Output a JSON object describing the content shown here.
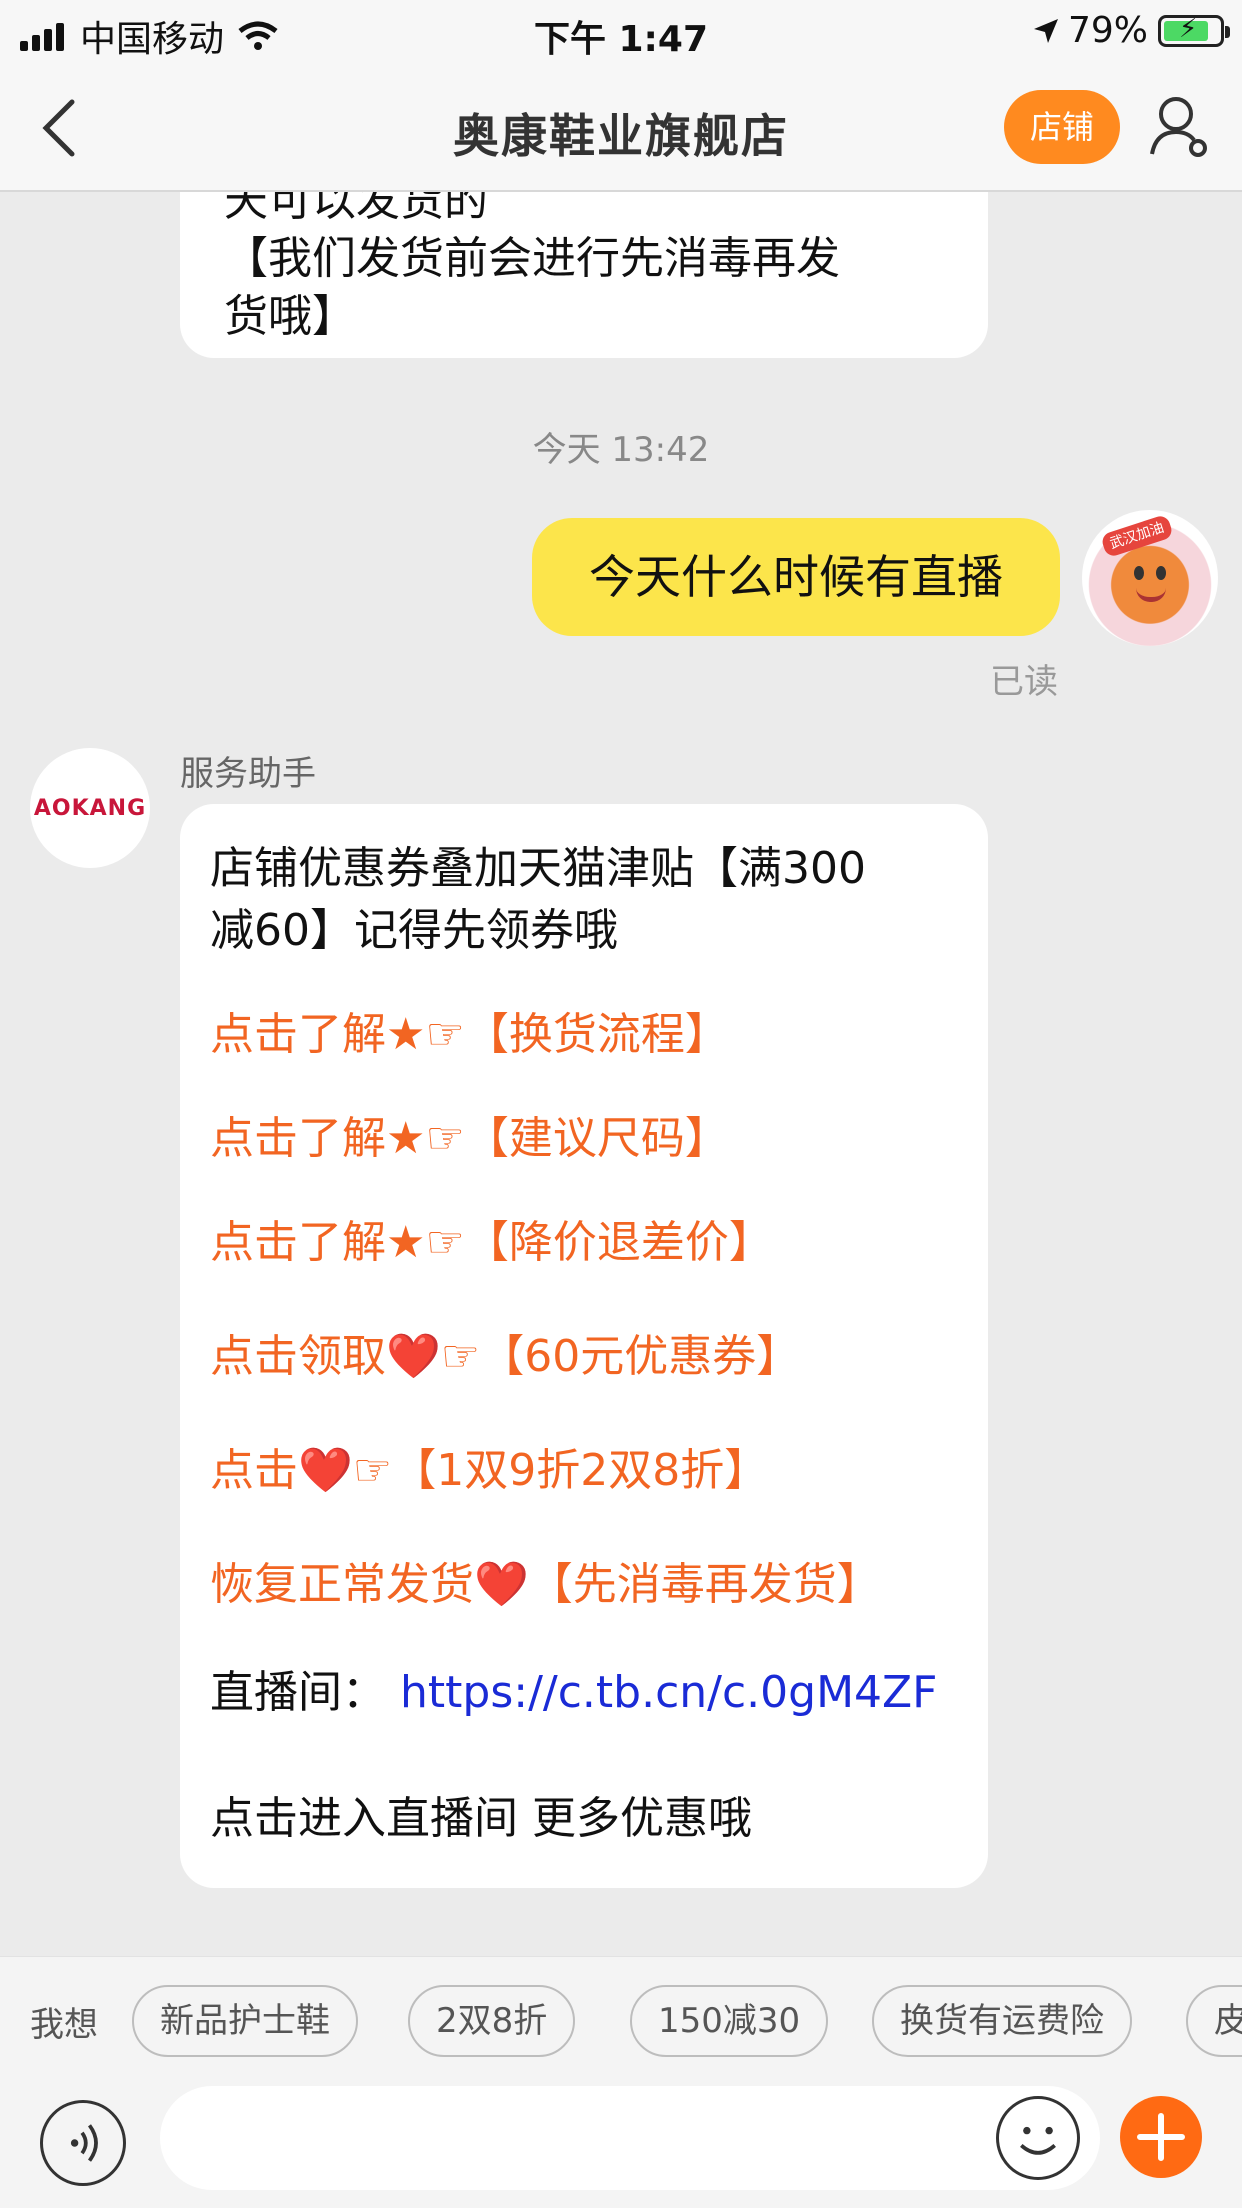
{
  "status_bar": {
    "carrier": "中国移动",
    "time": "下午 1:47",
    "battery": "79%"
  },
  "nav": {
    "title": "奥康鞋业旗舰店",
    "shop_button": "店铺"
  },
  "chat": {
    "prev_message_lines": [
      "天可以发货的",
      "【我们发货前会进行先消毒再发",
      "货哦】"
    ],
    "timestamp": "今天 13:42",
    "my_message": "今天什么时候有直播",
    "read_status": "已读",
    "my_avatar_badge": "武汉加油",
    "bot": {
      "avatar_text": "AOKANG",
      "sender": "服务助手",
      "intro_line1": "店铺优惠券叠加天猫津贴【满300",
      "intro_line2": "减60】记得先领券哦",
      "links": [
        "点击了解★☞【换货流程】",
        "点击了解★☞【建议尺码】",
        "点击了解★☞【降价退差价】",
        "点击领取❤️☞【60元优惠券】",
        "点击❤️☞【1双9折2双8折】",
        "恢复正常发货❤️【先消毒再发货】"
      ],
      "live_label": "直播间：",
      "live_url": "https://c.tb.cn/c.0gM4ZF",
      "footer": "点击进入直播间 更多优惠哦"
    }
  },
  "quick_replies": {
    "label": "我想",
    "chips": [
      "新品护士鞋",
      "2双8折",
      "150减30",
      "换货有运费险",
      "皮"
    ]
  },
  "input": {
    "placeholder": ""
  }
}
